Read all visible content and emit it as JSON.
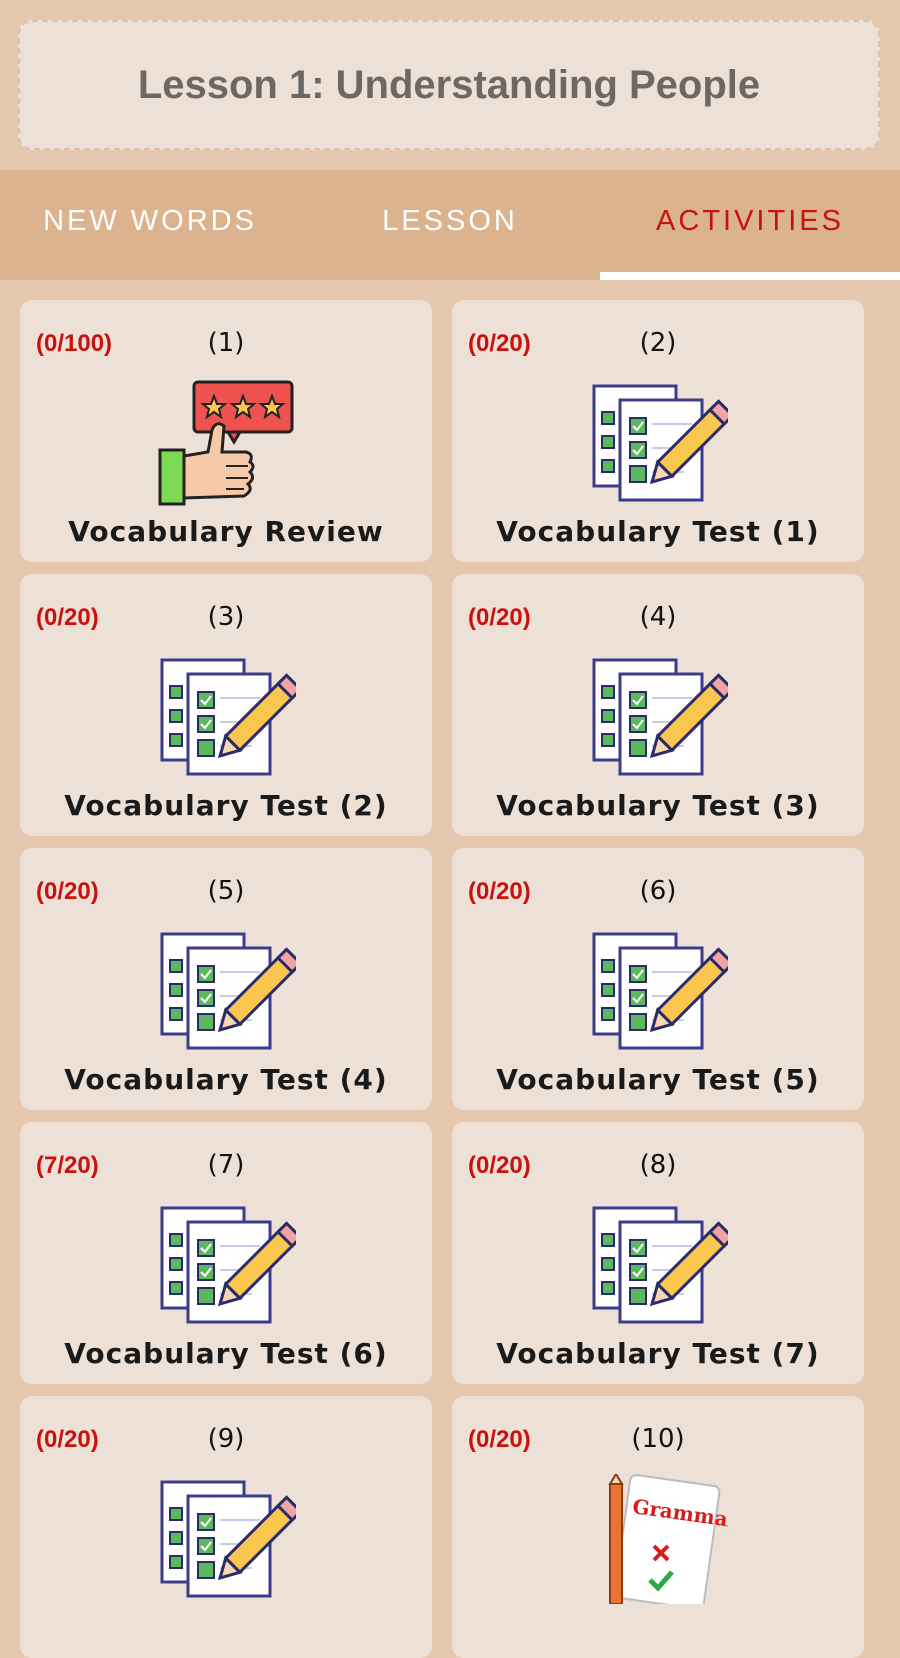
{
  "header": {
    "title": "Lesson 1: Understanding People"
  },
  "tabs": [
    {
      "label": "NEW WORDS",
      "active": false
    },
    {
      "label": "LESSON",
      "active": false
    },
    {
      "label": "ACTIVITIES",
      "active": true
    }
  ],
  "colors": {
    "background": "#e5c8ad",
    "tab_bar": "#dbb38f",
    "card": "#ede1d7",
    "accent_red": "#c8120e"
  },
  "activities": [
    {
      "score": "(0/100)",
      "number": "(1)",
      "title": "Vocabulary Review",
      "icon": "thumbs-up-rating-icon"
    },
    {
      "score": "(0/20)",
      "number": "(2)",
      "title": "Vocabulary Test (1)",
      "icon": "checklist-pencil-icon"
    },
    {
      "score": "(0/20)",
      "number": "(3)",
      "title": "Vocabulary Test (2)",
      "icon": "checklist-pencil-icon"
    },
    {
      "score": "(0/20)",
      "number": "(4)",
      "title": "Vocabulary Test (3)",
      "icon": "checklist-pencil-icon"
    },
    {
      "score": "(0/20)",
      "number": "(5)",
      "title": "Vocabulary Test (4)",
      "icon": "checklist-pencil-icon"
    },
    {
      "score": "(0/20)",
      "number": "(6)",
      "title": "Vocabulary Test (5)",
      "icon": "checklist-pencil-icon"
    },
    {
      "score": "(7/20)",
      "number": "(7)",
      "title": "Vocabulary Test (6)",
      "icon": "checklist-pencil-icon"
    },
    {
      "score": "(0/20)",
      "number": "(8)",
      "title": "Vocabulary Test (7)",
      "icon": "checklist-pencil-icon"
    },
    {
      "score": "(0/20)",
      "number": "(9)",
      "title": "",
      "icon": "checklist-pencil-icon"
    },
    {
      "score": "(0/20)",
      "number": "(10)",
      "title": "",
      "icon": "grammar-paper-icon",
      "icon_text": "Grammar"
    }
  ]
}
